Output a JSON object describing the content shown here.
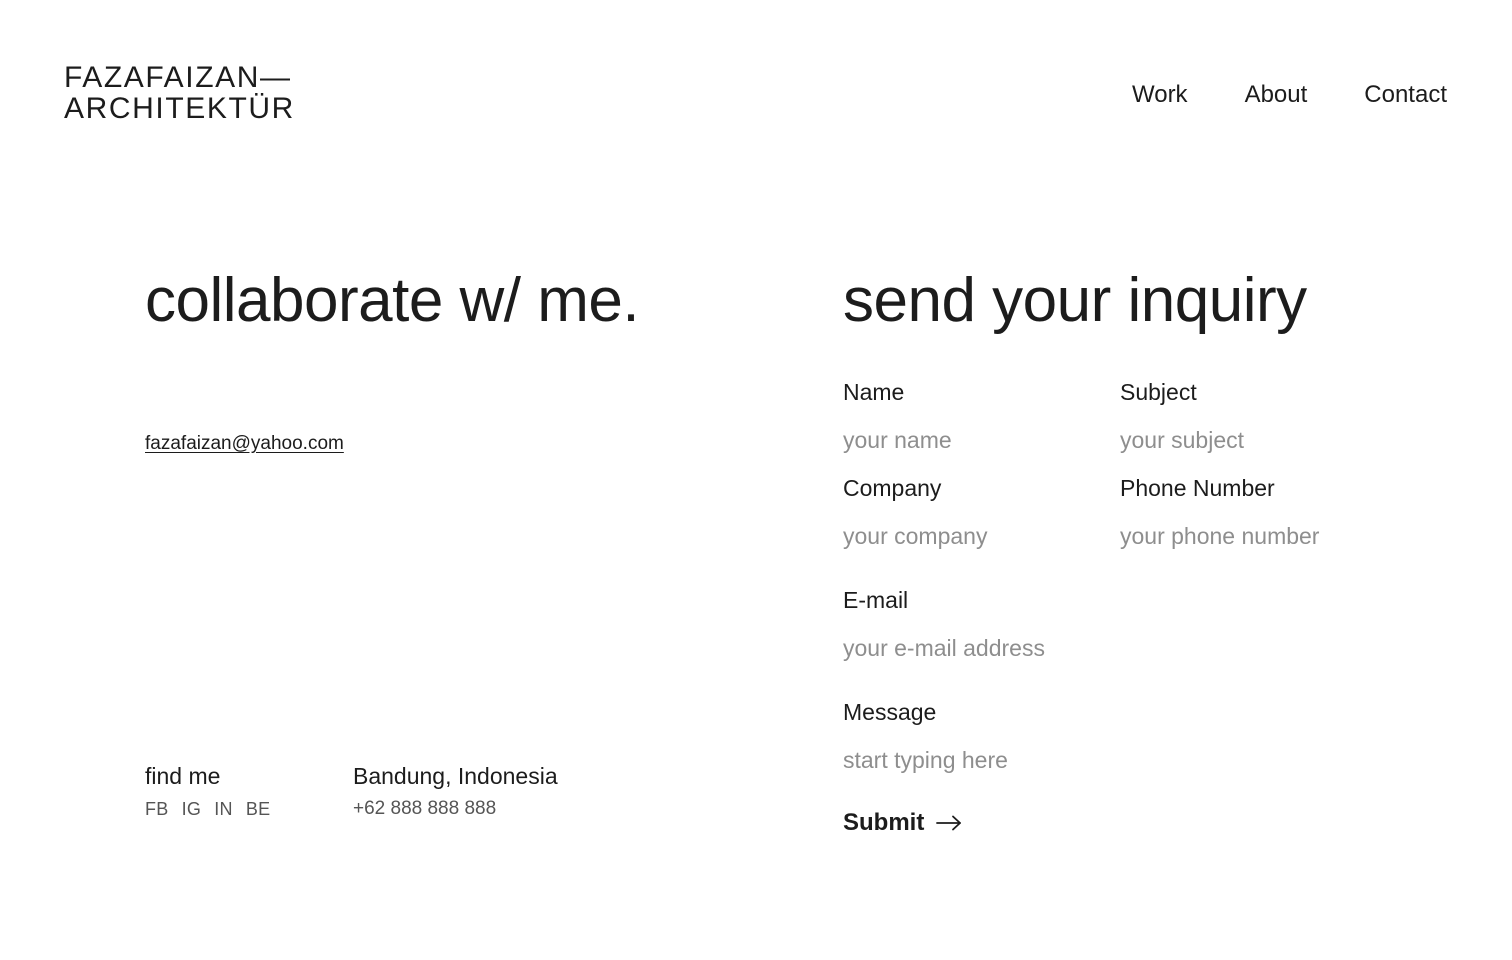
{
  "header": {
    "logo_line1": "FAZAFAIZAN—",
    "logo_line2": "ARCHITEKTÜR",
    "nav": [
      "Work",
      "About",
      "Contact"
    ]
  },
  "left": {
    "headline": "collaborate w/ me.",
    "email": "fazafaizan@yahoo.com",
    "find_me_label": "find me",
    "socials": [
      "FB",
      "IG",
      "IN",
      "BE"
    ],
    "city": "Bandung, Indonesia",
    "phone": "+62 888 888 888"
  },
  "form": {
    "headline": "send your inquiry",
    "name": {
      "label": "Name",
      "placeholder": "your name"
    },
    "subject": {
      "label": "Subject",
      "placeholder": "your subject"
    },
    "company": {
      "label": "Company",
      "placeholder": "your company"
    },
    "phone": {
      "label": "Phone Number",
      "placeholder": "your phone number"
    },
    "email": {
      "label": "E-mail",
      "placeholder": "your e-mail address"
    },
    "message": {
      "label": "Message",
      "placeholder": "start typing here"
    },
    "submit_label": "Submit",
    "submit_icon": "arrow-right-icon"
  }
}
